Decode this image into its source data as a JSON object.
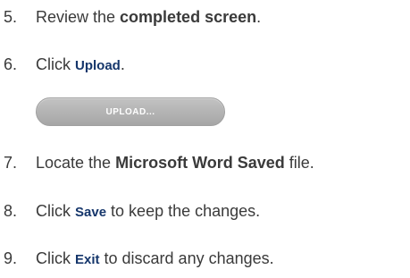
{
  "steps": [
    {
      "num": "5.",
      "pre": "Review the ",
      "bold": "completed screen",
      "post": "."
    },
    {
      "num": "6.",
      "pre": "Click ",
      "ui": "Upload",
      "post": "."
    },
    {
      "num": "7.",
      "pre": "Locate the ",
      "bold": "Microsoft Word Saved",
      "post": " file."
    },
    {
      "num": "8.",
      "pre": "Click ",
      "ui": "Save",
      "post": " to keep the changes."
    },
    {
      "num": "9.",
      "pre": "Click ",
      "ui": "Exit",
      "post": " to discard any changes."
    }
  ],
  "upload_button": {
    "label": "UPLOAD..."
  },
  "colors": {
    "text": "#3a3a3a",
    "ui_label": "#15366b",
    "button": "#b3b3b3"
  }
}
